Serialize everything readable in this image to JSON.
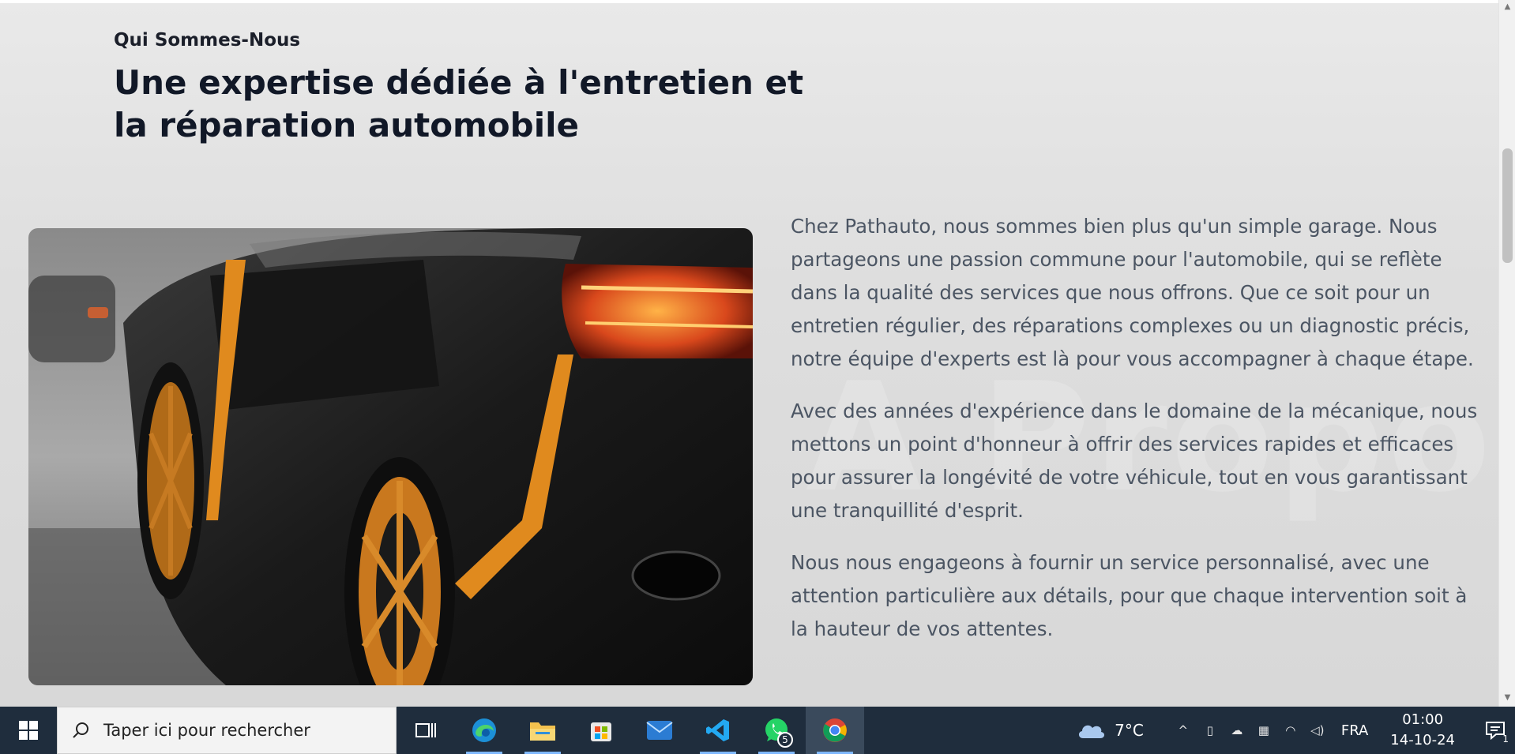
{
  "section": {
    "eyebrow": "Qui Sommes-Nous",
    "headline": "Une expertise dédiée à l'entretien et la réparation automobile",
    "watermark": "A Propos",
    "paragraphs": [
      "Chez Pathauto, nous sommes bien plus qu'un simple garage. Nous partageons une passion commune pour l'automobile, qui se reflète dans la qualité des services que nous offrons. Que ce soit pour un entretien régulier, des réparations complexes ou un diagnostic précis, notre équipe d'experts est là pour vous accompagner à chaque étape.",
      "Avec des années d'expérience dans le domaine de la mécanique, nous mettons un point d'honneur à offrir des services rapides et efficaces pour assurer la longévité de votre véhicule, tout en vous garantissant une tranquillité d'esprit.",
      "Nous nous engageons à fournir un service personnalisé, avec une attention particulière aux détails, pour que chaque intervention soit à la hauteur de vos attentes."
    ],
    "image_description_icon": "car-photo"
  },
  "taskbar": {
    "search_placeholder": "Taper ici pour rechercher",
    "apps": [
      {
        "name": "task-view",
        "active": false
      },
      {
        "name": "edge",
        "active": false
      },
      {
        "name": "file-explorer",
        "active": false
      },
      {
        "name": "microsoft-store",
        "active": false
      },
      {
        "name": "mail",
        "active": false
      },
      {
        "name": "vscode",
        "active": false
      },
      {
        "name": "whatsapp",
        "active": false,
        "badge": "5"
      },
      {
        "name": "chrome",
        "active": true
      }
    ],
    "weather": "7°C",
    "language": "FRA",
    "time": "01:00",
    "date": "14-10-24",
    "notification_count": "1"
  },
  "colors": {
    "taskbar_bg": "#1f2d3d",
    "accent_orange": "#e08a1e",
    "text_dark": "#111827",
    "text_body": "#4b5563"
  }
}
